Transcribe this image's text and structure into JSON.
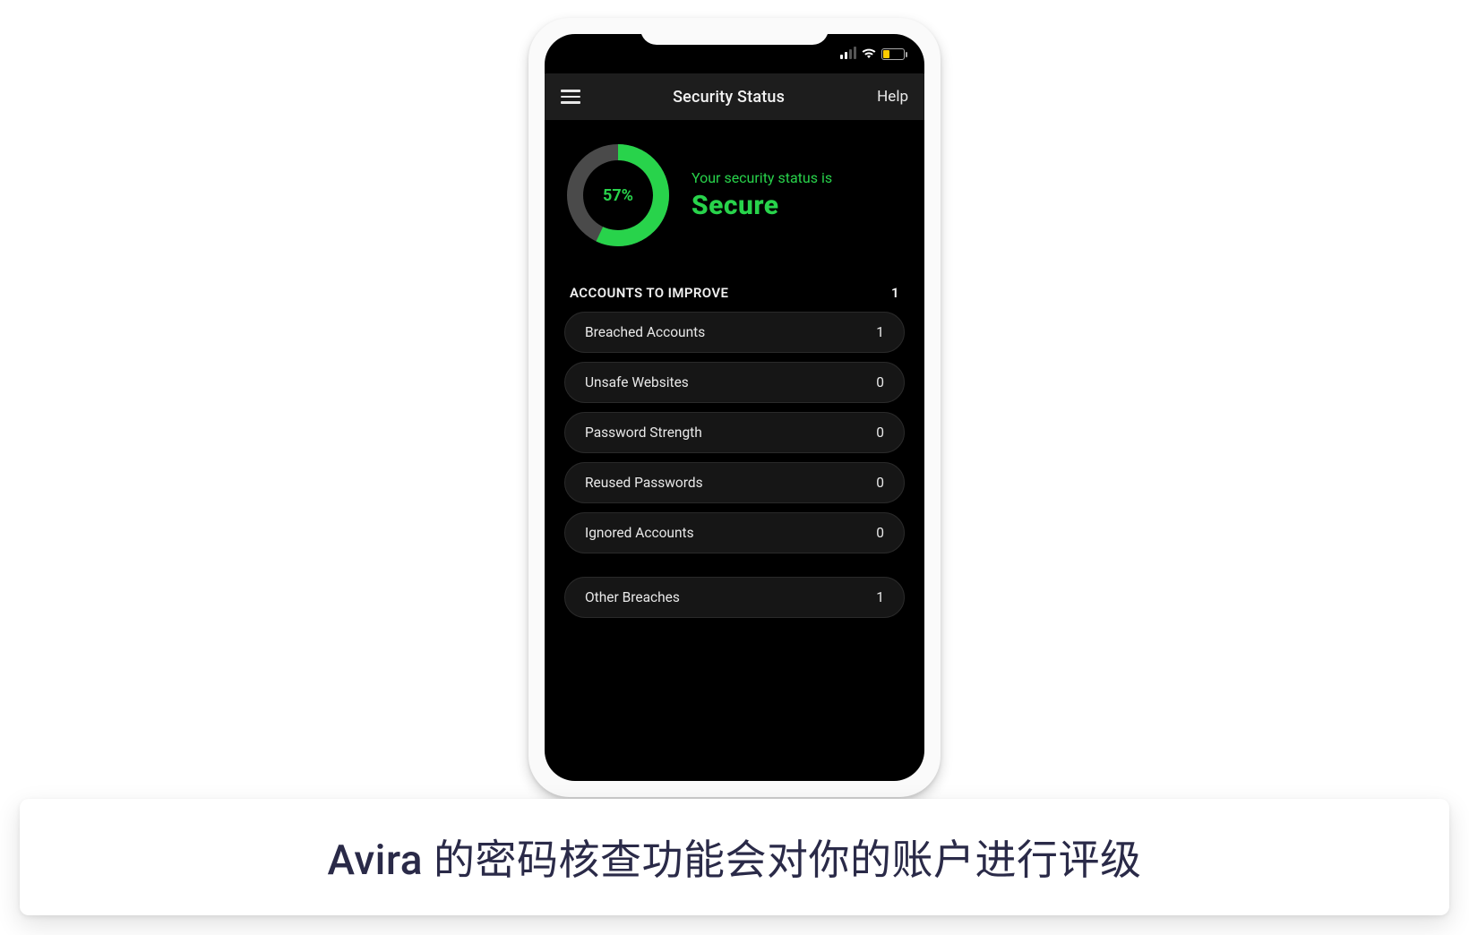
{
  "header": {
    "title": "Security Status",
    "help_label": "Help"
  },
  "status": {
    "percent_label": "57%",
    "percent_value": 57,
    "line1": "Your security status is",
    "line2": "Secure",
    "colors": {
      "accent": "#28d34b",
      "track": "#4a4a4a"
    }
  },
  "section": {
    "title": "ACCOUNTS TO IMPROVE",
    "count": "1"
  },
  "items": [
    {
      "label": "Breached Accounts",
      "count": "1"
    },
    {
      "label": "Unsafe Websites",
      "count": "0"
    },
    {
      "label": "Password Strength",
      "count": "0"
    },
    {
      "label": "Reused Passwords",
      "count": "0"
    },
    {
      "label": "Ignored Accounts",
      "count": "0"
    }
  ],
  "other": {
    "label": "Other Breaches",
    "count": "1"
  },
  "caption": "Avira 的密码核查功能会对你的账户进行评级",
  "chart_data": {
    "type": "pie",
    "title": "Security Status",
    "categories": [
      "Secure",
      "Remaining"
    ],
    "values": [
      57,
      43
    ],
    "colors": [
      "#28d34b",
      "#4a4a4a"
    ]
  }
}
